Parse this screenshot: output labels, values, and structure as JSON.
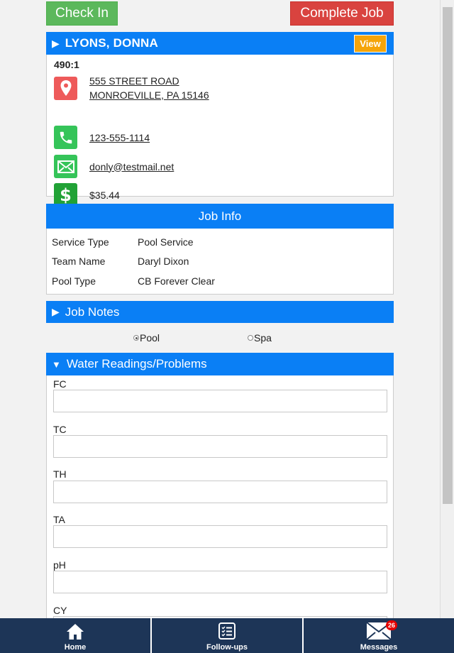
{
  "actions": {
    "check_in": "Check In",
    "complete_job": "Complete Job"
  },
  "customer": {
    "name": "LYONS, DONNA",
    "view_label": "View",
    "account": "490:1",
    "address_line1": "555 STREET ROAD",
    "address_line2": "MONROEVILLE, PA 15146",
    "phone": "123-555-1114",
    "email": "donly@testmail.net",
    "balance": "$35.44"
  },
  "job_info": {
    "title": "Job Info",
    "rows": [
      {
        "label": "Service Type",
        "value": "Pool Service"
      },
      {
        "label": "Team Name",
        "value": "Daryl Dixon"
      },
      {
        "label": "Pool Type",
        "value": "CB Forever Clear"
      }
    ]
  },
  "job_notes": {
    "title": "Job Notes"
  },
  "body_type": {
    "selected": "Pool",
    "options": [
      "Pool",
      "Spa"
    ]
  },
  "water": {
    "title": "Water Readings/Problems",
    "fields": [
      {
        "label": "FC",
        "value": ""
      },
      {
        "label": "TC",
        "value": ""
      },
      {
        "label": "TH",
        "value": ""
      },
      {
        "label": "TA",
        "value": ""
      },
      {
        "label": "pH",
        "value": ""
      },
      {
        "label": "CY",
        "value": ""
      }
    ]
  },
  "nav": {
    "home": "Home",
    "followups": "Follow-ups",
    "messages": "Messages",
    "messages_badge": "26"
  },
  "colors": {
    "header_blue": "#0a7ff5",
    "nav_navy": "#1d3557",
    "check_in_green": "#5cb85c",
    "complete_red": "#d9433f",
    "view_orange": "#f5a40a"
  }
}
